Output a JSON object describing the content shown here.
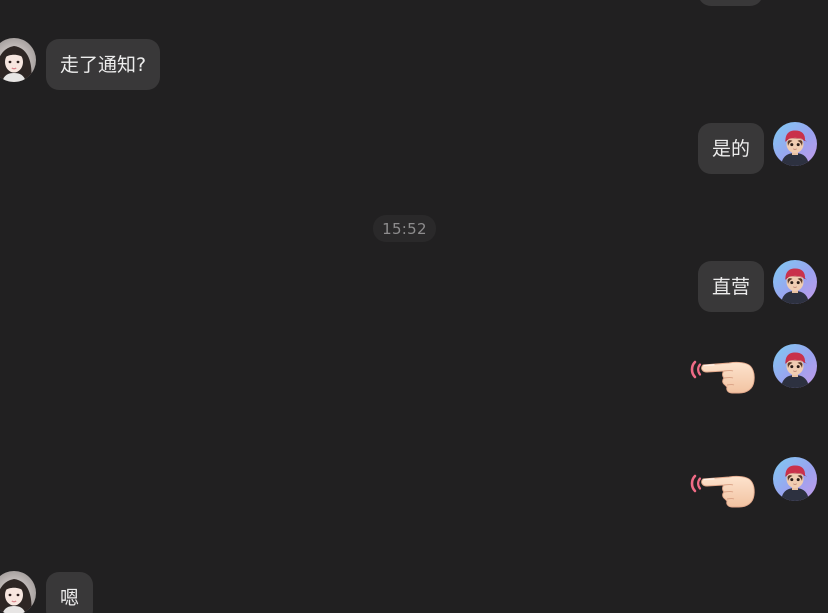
{
  "conversation": {
    "timestamp": "15:52",
    "messages": [
      {
        "id": "msg-partial-top",
        "side": "right",
        "type": "text",
        "text": ""
      },
      {
        "id": "msg-1",
        "side": "left",
        "type": "text",
        "text": "走了通知?",
        "avatar": "female-avatar"
      },
      {
        "id": "msg-2",
        "side": "right",
        "type": "text",
        "text": "是的",
        "avatar": "cartoon-boy-avatar"
      },
      {
        "id": "msg-3",
        "side": "right",
        "type": "text",
        "text": "直营",
        "avatar": "cartoon-boy-avatar"
      },
      {
        "id": "msg-4",
        "side": "right",
        "type": "sticker",
        "sticker": "pointing-hand-emoji",
        "avatar": "cartoon-boy-avatar"
      },
      {
        "id": "msg-5",
        "side": "right",
        "type": "sticker",
        "sticker": "pointing-hand-emoji",
        "avatar": "cartoon-boy-avatar"
      },
      {
        "id": "msg-6",
        "side": "left",
        "type": "text",
        "text": "嗯",
        "avatar": "female-avatar"
      }
    ]
  },
  "colors": {
    "background": "#212021",
    "bubble": "#393839",
    "bubble_text": "#ededed",
    "timestamp_text": "#8d8c8d"
  }
}
